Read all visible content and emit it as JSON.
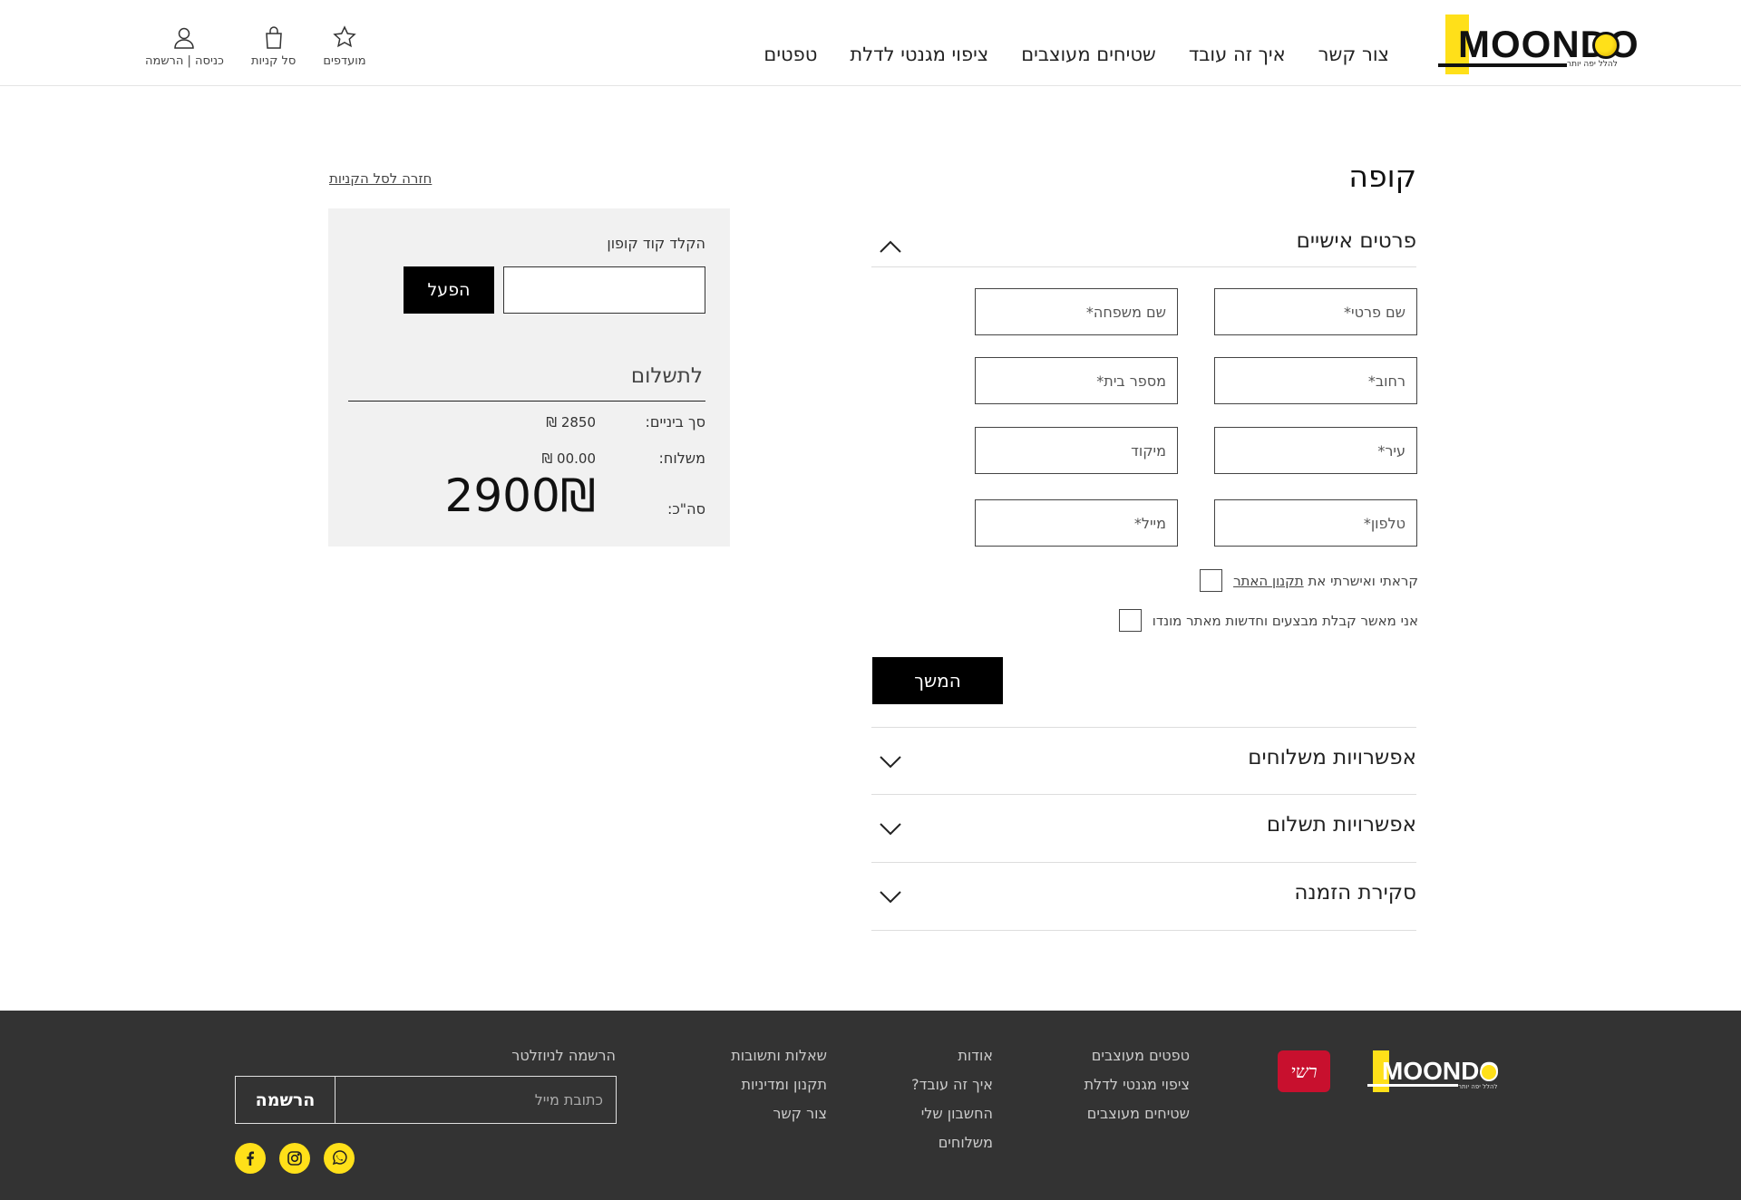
{
  "brand": {
    "logo_text": "MOONDO",
    "tagline": "להלל יפה יותר",
    "accent_color": "#ffe019",
    "dark_color": "#333333"
  },
  "nav": {
    "items": [
      "טפטים",
      "ציפוי מגנטי לדלת",
      "שטיחים מעוצבים",
      "איך זה עובד",
      "צור קשר"
    ]
  },
  "utility": {
    "favorites": "מועדפים",
    "cart": "סל קניות",
    "login": "כניסה | הרשמה"
  },
  "checkout": {
    "title": "קופה",
    "sections": {
      "personal": "פרטים אישיים",
      "shipping": "אפשרויות משלוחים",
      "payment": "אפשרויות תשלום",
      "review": "סקירת הזמנה"
    },
    "fields": {
      "first_name": "שם פרטי*",
      "last_name": "שם משפחה*",
      "street": "רחוב*",
      "house_number": "מספר בית*",
      "city": "עיר*",
      "zip": "מיקוד",
      "phone": "טלפון*",
      "email": "מייל*"
    },
    "terms_prefix": "קראתי ואישרתי את",
    "terms_link": "תקנון האתר",
    "newsletter_consent": "אני מאשר קבלת מבצעים וחדשות מאתר מונדו",
    "continue": "המשך"
  },
  "summary": {
    "back_link": "חזרה לסל הקניות",
    "coupon_label": "הקלד קוד קופון",
    "coupon_button": "הפעל",
    "pay_title": "לתשלום",
    "subtotal_label": "סך ביניים:",
    "subtotal_value": "2850 ₪",
    "shipping_label": "משלוח:",
    "shipping_value": "00.00 ₪",
    "total_label": "סה\"כ:",
    "total_value": "2900₪"
  },
  "footer": {
    "badge_text": "רשי",
    "col1": [
      "טפטים מעוצבים",
      "ציפוי מגנטי לדלת",
      "שטיחים מעוצבים"
    ],
    "col2": [
      "אודות",
      "איך זה עובד?",
      "החשבון שלי",
      "משלוחים"
    ],
    "col3": [
      "שאלות ותשובות",
      "תקנון ומדיניות",
      "צור קשר"
    ],
    "newsletter_title": "הרשמה לניוזלטר",
    "email_placeholder": "כתובת מייל",
    "signup_button": "הרשמה",
    "social": [
      "whatsapp-icon",
      "instagram-icon",
      "facebook-icon"
    ]
  }
}
